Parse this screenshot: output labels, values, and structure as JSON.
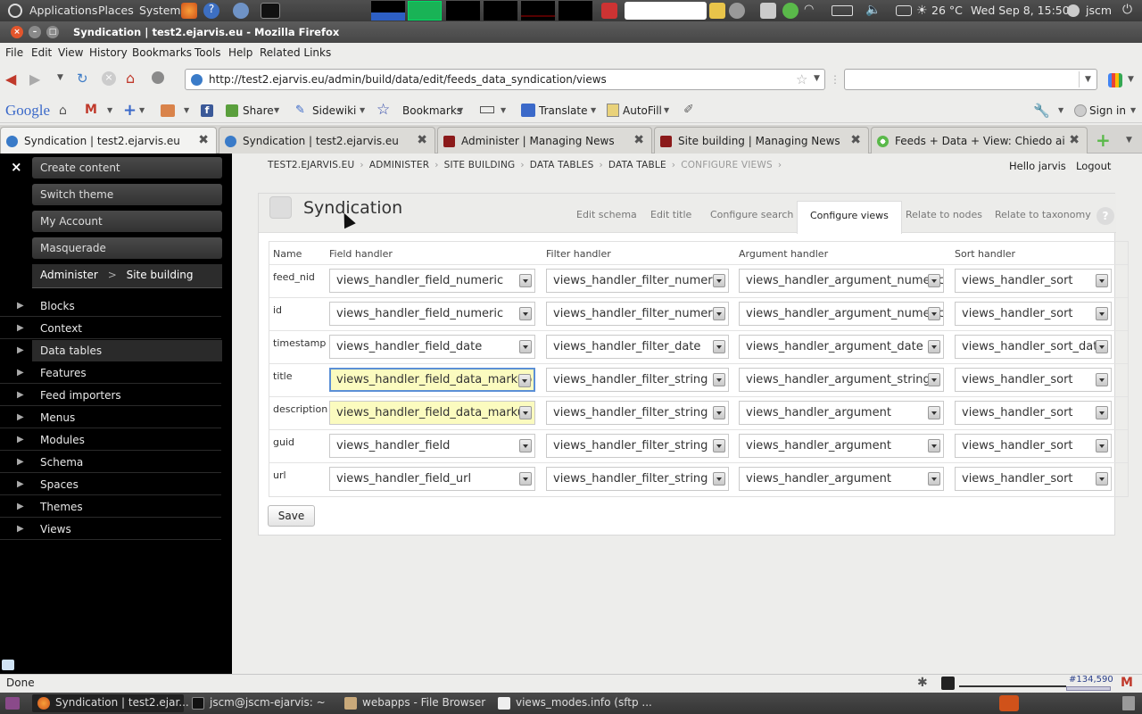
{
  "panel": {
    "menus": [
      "Applications",
      "Places",
      "System"
    ],
    "weather": "26 °C",
    "clock": "Wed Sep  8, 15:50",
    "user": "jscm"
  },
  "window": {
    "title": "Syndication | test2.ejarvis.eu - Mozilla Firefox"
  },
  "firefox": {
    "menus": [
      "File",
      "Edit",
      "View",
      "History",
      "Bookmarks",
      "Tools",
      "Help",
      "Related Links"
    ],
    "url": "http://test2.ejarvis.eu/admin/build/data/edit/feeds_data_syndication/views",
    "search_value": ""
  },
  "google_toolbar": {
    "logo": "Google",
    "share": "Share",
    "sidewiki": "Sidewiki",
    "bookmarks": "Bookmarks",
    "translate": "Translate",
    "autofill": "AutoFill",
    "signin": "Sign in"
  },
  "tabs": [
    {
      "label": "Syndication | test2.ejarvis.eu",
      "active": true
    },
    {
      "label": "Syndication | test2.ejarvis.eu",
      "active": false
    },
    {
      "label": "Administer | Managing News",
      "active": false
    },
    {
      "label": "Site building | Managing News",
      "active": false
    },
    {
      "label": "Feeds + Data + View: Chiedo ai...",
      "active": false
    }
  ],
  "sidebar": {
    "close": "×",
    "buttons": [
      "Create content",
      "Switch theme",
      "My Account",
      "Masquerade"
    ],
    "crumb": {
      "first": "Administer",
      "sep": ">",
      "second": "Site building"
    },
    "items": [
      "Blocks",
      "Context",
      "Data tables",
      "Features",
      "Feed importers",
      "Menus",
      "Modules",
      "Schema",
      "Spaces",
      "Themes",
      "Views"
    ],
    "active_item": "Data tables"
  },
  "breadcrumb": [
    "TEST2.EJARVIS.EU",
    "ADMINISTER",
    "SITE BUILDING",
    "DATA TABLES",
    "DATA TABLE",
    "CONFIGURE VIEWS"
  ],
  "user_links": {
    "hello": "Hello jarvis",
    "logout": "Logout"
  },
  "page": {
    "title": "Syndication",
    "tabs": [
      "Edit schema",
      "Edit title",
      "Configure search",
      "Configure views",
      "Relate to nodes",
      "Relate to taxonomy"
    ],
    "active_tab": "Configure views",
    "help": "?"
  },
  "table": {
    "headers": [
      "Name",
      "Field handler",
      "Filter handler",
      "Argument handler",
      "Sort handler"
    ],
    "rows": [
      {
        "name": "feed_nid",
        "field": "views_handler_field_numeric",
        "filter": "views_handler_filter_numeric",
        "argument": "views_handler_argument_numeric",
        "sort": "views_handler_sort"
      },
      {
        "name": "id",
        "field": "views_handler_field_numeric",
        "filter": "views_handler_filter_numeric",
        "argument": "views_handler_argument_numeric",
        "sort": "views_handler_sort"
      },
      {
        "name": "timestamp",
        "field": "views_handler_field_date",
        "filter": "views_handler_filter_date",
        "argument": "views_handler_argument_date",
        "sort": "views_handler_sort_date"
      },
      {
        "name": "title",
        "field": "views_handler_field_data_markup",
        "filter": "views_handler_filter_string",
        "argument": "views_handler_argument_string",
        "sort": "views_handler_sort"
      },
      {
        "name": "description",
        "field": "views_handler_field_data_markup",
        "filter": "views_handler_filter_string",
        "argument": "views_handler_argument",
        "sort": "views_handler_sort"
      },
      {
        "name": "guid",
        "field": "views_handler_field",
        "filter": "views_handler_filter_string",
        "argument": "views_handler_argument",
        "sort": "views_handler_sort"
      },
      {
        "name": "url",
        "field": "views_handler_field_url",
        "filter": "views_handler_filter_string",
        "argument": "views_handler_argument",
        "sort": "views_handler_sort"
      }
    ],
    "save": "Save"
  },
  "statusbar": {
    "text": "Done",
    "counter": "#134,590"
  },
  "taskbar": [
    "Syndication | test2.ejar...",
    "jscm@jscm-ejarvis: ~",
    "webapps - File Browser",
    "views_modes.info (sftp ..."
  ]
}
